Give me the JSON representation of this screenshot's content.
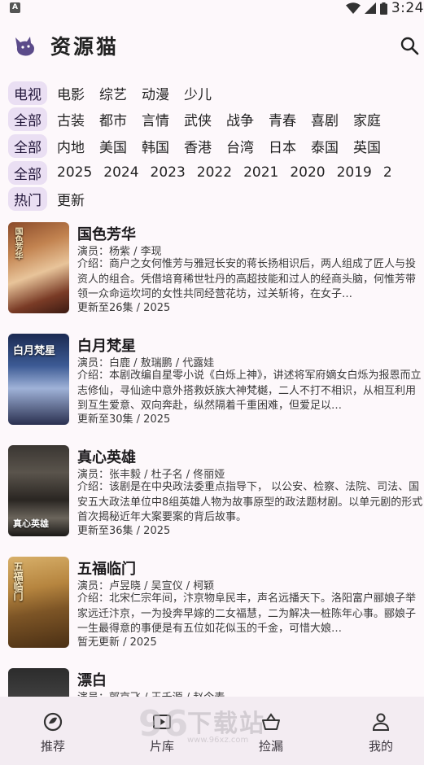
{
  "status_bar": {
    "time": "3:24",
    "app_badge": "A"
  },
  "app": {
    "title": "资源猫"
  },
  "filters": {
    "type": [
      "电视",
      "电影",
      "综艺",
      "动漫",
      "少儿"
    ],
    "genre": [
      "全部",
      "古装",
      "都市",
      "言情",
      "武侠",
      "战争",
      "青春",
      "喜剧",
      "家庭"
    ],
    "region": [
      "全部",
      "内地",
      "美国",
      "韩国",
      "香港",
      "台湾",
      "日本",
      "泰国",
      "英国"
    ],
    "year": [
      "全部",
      "2025",
      "2024",
      "2023",
      "2022",
      "2021",
      "2020",
      "2019",
      "2"
    ],
    "sort": [
      "热门",
      "更新"
    ]
  },
  "media": [
    {
      "title": "国色芳华",
      "actors": "演员：杨紫 / 李现",
      "intro": "介绍：商户之女何惟芳与雅冠长安的蒋长扬相识后，两人组成了匠人与投资人的组合。凭借培育稀世牡丹的高超技能和过人的经商头脑，何惟芳带领一众命运坎坷的女性共同经营花坊，过关斩将，在女子…",
      "update": "更新至26集 / 2025",
      "poster_text": "国色芳华"
    },
    {
      "title": "白月梵星",
      "actors": "演员：白鹿 / 敖瑞鹏 / 代露娃",
      "intro": "介绍：本剧改编自星零小说《白烁上神》，讲述将军府嫡女白烁为报恩而立志修仙，寻仙途中意外搭救妖族大神梵樾，二人不打不相识，从相互利用到互生爱意、双向奔赴，纵然隔着千重困难，但爱足以…",
      "update": "更新至30集 / 2025",
      "poster_text": "白月梵星"
    },
    {
      "title": "真心英雄",
      "actors": "演员：张丰毅 / 杜子名 / 佟丽娅",
      "intro": "介绍：该剧是在中央政法委重点指导下， 以公安、检察、法院、司法、国安五大政法单位中8组英雄人物为故事原型的政法题材剧。以单元剧的形式首次揭秘近年大案要案的背后故事。",
      "update": "更新至36集 / 2025",
      "poster_text": "真心英雄"
    },
    {
      "title": "五福临门",
      "actors": "演员：卢昱晓 / 吴宣仪 / 柯颖",
      "intro": "介绍：北宋仁宗年间，汴京物阜民丰，声名远播天下。洛阳富户郦娘子举家远迁汴京，一为投奔早嫁的二女福慧，二为解决一桩陈年心事。郦娘子一生最得意的事便是有五位如花似玉的千金，可惜大娘…",
      "update": "暂无更新 / 2025",
      "poster_text": "五福临门"
    },
    {
      "title": "漂白",
      "actors": "演员：郭京飞 / 王千源 / 赵今麦",
      "intro": "",
      "update": "",
      "poster_text": ""
    }
  ],
  "nav": [
    {
      "label": "推荐",
      "icon": "recommend-icon"
    },
    {
      "label": "片库",
      "icon": "library-icon"
    },
    {
      "label": "捡漏",
      "icon": "basket-icon"
    },
    {
      "label": "我的",
      "icon": "profile-icon"
    }
  ],
  "watermark": {
    "text": "下载站",
    "url": "www.96xz.com"
  },
  "colors": {
    "chip_bg": "#eadff3",
    "background": "#fdf8fb",
    "nav_bg": "#f3ecf2"
  }
}
